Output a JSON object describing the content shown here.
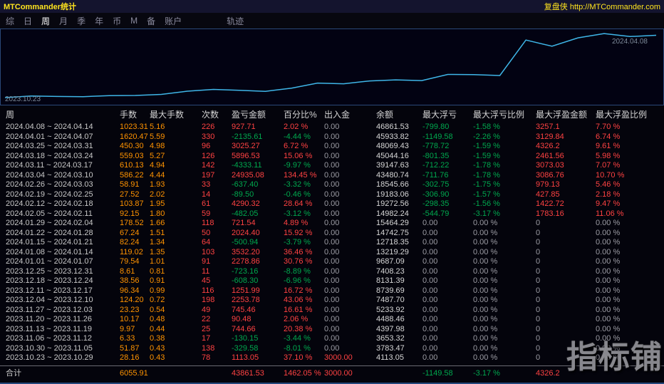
{
  "title_bar": {
    "title": "MTCommander统计",
    "right_text": "复盘侠 http://MTCommander.com"
  },
  "menu": {
    "items": [
      "综",
      "日",
      "周",
      "月",
      "季",
      "年",
      "币",
      "M",
      "备",
      "账户"
    ],
    "selected": "周",
    "extra_item": "轨迹"
  },
  "chart_data": {
    "type": "line",
    "title": "",
    "xlabel": "",
    "ylabel": "",
    "x_start_label": "2023.10.23",
    "x_end_label": "2024.04.08",
    "legend": "none",
    "grid": false,
    "line_color": "#3fb6e8",
    "ylim": [
      3000,
      48100
    ],
    "series": [
      {
        "name": "余额",
        "values": [
          3000,
          4113.05,
          3783.47,
          3653.32,
          4397.98,
          4488.46,
          5233.92,
          7487.7,
          8739.69,
          8131.39,
          7408.23,
          9687.09,
          13219.29,
          12718.35,
          14742.75,
          15464.29,
          14982.24,
          19272.56,
          19183.06,
          18545.66,
          43480.74,
          39147.63,
          45044.16,
          48069.43,
          45933.82,
          46861.53
        ]
      }
    ]
  },
  "table": {
    "headers": [
      "周",
      "手数",
      "最大手数",
      "次数",
      "盈亏金额",
      "百分比%",
      "出入金",
      "余额",
      "最大浮亏",
      "最大浮亏比例",
      "最大浮盈金额",
      "最大浮盈比例"
    ],
    "rows": [
      [
        "2024.04.08 ~ 2024.04.14",
        "1023.31",
        "5.16",
        "226",
        "927.71",
        "2.02 %",
        "0.00",
        "46861.53",
        "-799.80",
        "-1.58 %",
        "3257.1",
        "7.70 %"
      ],
      [
        "2024.04.01 ~ 2024.04.07",
        "1620.47",
        "5.59",
        "330",
        "-2135.61",
        "-4.44 %",
        "0.00",
        "45933.82",
        "-1149.58",
        "-2.26 %",
        "3129.84",
        "6.74 %"
      ],
      [
        "2024.03.25 ~ 2024.03.31",
        "450.30",
        "4.98",
        "96",
        "3025.27",
        "6.72 %",
        "0.00",
        "48069.43",
        "-778.72",
        "-1.59 %",
        "4326.2",
        "9.61 %"
      ],
      [
        "2024.03.18 ~ 2024.03.24",
        "559.03",
        "5.27",
        "126",
        "5896.53",
        "15.06 %",
        "0.00",
        "45044.16",
        "-801.35",
        "-1.59 %",
        "2461.56",
        "5.98 %"
      ],
      [
        "2024.03.11 ~ 2024.03.17",
        "610.13",
        "4.94",
        "142",
        "-4333.11",
        "-9.97 %",
        "0.00",
        "39147.63",
        "-712.22",
        "-1.78 %",
        "3073.03",
        "7.07 %"
      ],
      [
        "2024.03.04 ~ 2024.03.10",
        "586.22",
        "4.44",
        "197",
        "24935.08",
        "134.45 %",
        "0.00",
        "43480.74",
        "-711.76",
        "-1.78 %",
        "3086.76",
        "10.70 %"
      ],
      [
        "2024.02.26 ~ 2024.03.03",
        "58.91",
        "1.93",
        "33",
        "-637.40",
        "-3.32 %",
        "0.00",
        "18545.66",
        "-302.75",
        "-1.75 %",
        "979.13",
        "5.46 %"
      ],
      [
        "2024.02.19 ~ 2024.02.25",
        "27.52",
        "2.02",
        "14",
        "-89.50",
        "-0.46 %",
        "0.00",
        "19183.06",
        "-306.90",
        "-1.57 %",
        "427.85",
        "2.18 %"
      ],
      [
        "2024.02.12 ~ 2024.02.18",
        "103.87",
        "1.95",
        "61",
        "4290.32",
        "28.64 %",
        "0.00",
        "19272.56",
        "-298.35",
        "-1.56 %",
        "1422.72",
        "9.47 %"
      ],
      [
        "2024.02.05 ~ 2024.02.11",
        "92.15",
        "1.80",
        "59",
        "-482.05",
        "-3.12 %",
        "0.00",
        "14982.24",
        "-544.79",
        "-3.17 %",
        "1783.16",
        "11.06 %"
      ],
      [
        "2024.01.29 ~ 2024.02.04",
        "178.52",
        "1.66",
        "118",
        "721.54",
        "4.89 %",
        "0.00",
        "15464.29",
        "0.00",
        "0.00 %",
        "0",
        "0.00 %"
      ],
      [
        "2024.01.22 ~ 2024.01.28",
        "67.24",
        "1.51",
        "50",
        "2024.40",
        "15.92 %",
        "0.00",
        "14742.75",
        "0.00",
        "0.00 %",
        "0",
        "0.00 %"
      ],
      [
        "2024.01.15 ~ 2024.01.21",
        "82.24",
        "1.34",
        "64",
        "-500.94",
        "-3.79 %",
        "0.00",
        "12718.35",
        "0.00",
        "0.00 %",
        "0",
        "0.00 %"
      ],
      [
        "2024.01.08 ~ 2024.01.14",
        "119.02",
        "1.35",
        "103",
        "3532.20",
        "36.46 %",
        "0.00",
        "13219.29",
        "0.00",
        "0.00 %",
        "0",
        "0.00 %"
      ],
      [
        "2024.01.01 ~ 2024.01.07",
        "79.54",
        "1.01",
        "91",
        "2278.86",
        "30.76 %",
        "0.00",
        "9687.09",
        "0.00",
        "0.00 %",
        "0",
        "0.00 %"
      ],
      [
        "2023.12.25 ~ 2023.12.31",
        "8.61",
        "0.81",
        "11",
        "-723.16",
        "-8.89 %",
        "0.00",
        "7408.23",
        "0.00",
        "0.00 %",
        "0",
        "0.00 %"
      ],
      [
        "2023.12.18 ~ 2023.12.24",
        "38.56",
        "0.91",
        "45",
        "-608.30",
        "-6.96 %",
        "0.00",
        "8131.39",
        "0.00",
        "0.00 %",
        "0",
        "0.00 %"
      ],
      [
        "2023.12.11 ~ 2023.12.17",
        "96.34",
        "0.99",
        "116",
        "1251.99",
        "16.72 %",
        "0.00",
        "8739.69",
        "0.00",
        "0.00 %",
        "0",
        "0.00 %"
      ],
      [
        "2023.12.04 ~ 2023.12.10",
        "124.20",
        "0.72",
        "198",
        "2253.78",
        "43.06 %",
        "0.00",
        "7487.70",
        "0.00",
        "0.00 %",
        "0",
        "0.00 %"
      ],
      [
        "2023.11.27 ~ 2023.12.03",
        "23.23",
        "0.54",
        "49",
        "745.46",
        "16.61 %",
        "0.00",
        "5233.92",
        "0.00",
        "0.00 %",
        "0",
        "0.00 %"
      ],
      [
        "2023.11.20 ~ 2023.11.26",
        "10.17",
        "0.48",
        "22",
        "90.48",
        "2.06 %",
        "0.00",
        "4488.46",
        "0.00",
        "0.00 %",
        "0",
        "0.00 %"
      ],
      [
        "2023.11.13 ~ 2023.11.19",
        "9.97",
        "0.44",
        "25",
        "744.66",
        "20.38 %",
        "0.00",
        "4397.98",
        "0.00",
        "0.00 %",
        "0",
        "0.00 %"
      ],
      [
        "2023.11.06 ~ 2023.11.12",
        "6.33",
        "0.38",
        "17",
        "-130.15",
        "-3.44 %",
        "0.00",
        "3653.32",
        "0.00",
        "0.00 %",
        "0",
        "0.00 %"
      ],
      [
        "2023.10.30 ~ 2023.11.05",
        "51.87",
        "0.43",
        "138",
        "-329.58",
        "-8.01 %",
        "0.00",
        "3783.47",
        "0.00",
        "0.00 %",
        "0",
        "0.00 %"
      ],
      [
        "2023.10.23 ~ 2023.10.29",
        "28.16",
        "0.43",
        "78",
        "1113.05",
        "37.10 %",
        "3000.00",
        "4113.05",
        "0.00",
        "0.00 %",
        "0",
        "0.00 %"
      ]
    ],
    "total_row": [
      "合计",
      "6055.91",
      "",
      "",
      "43861.53",
      "1462.05 %",
      "3000.00",
      "",
      "-1149.58",
      "-3.17 %",
      "4326.2",
      ""
    ]
  },
  "watermark": "指标铺"
}
